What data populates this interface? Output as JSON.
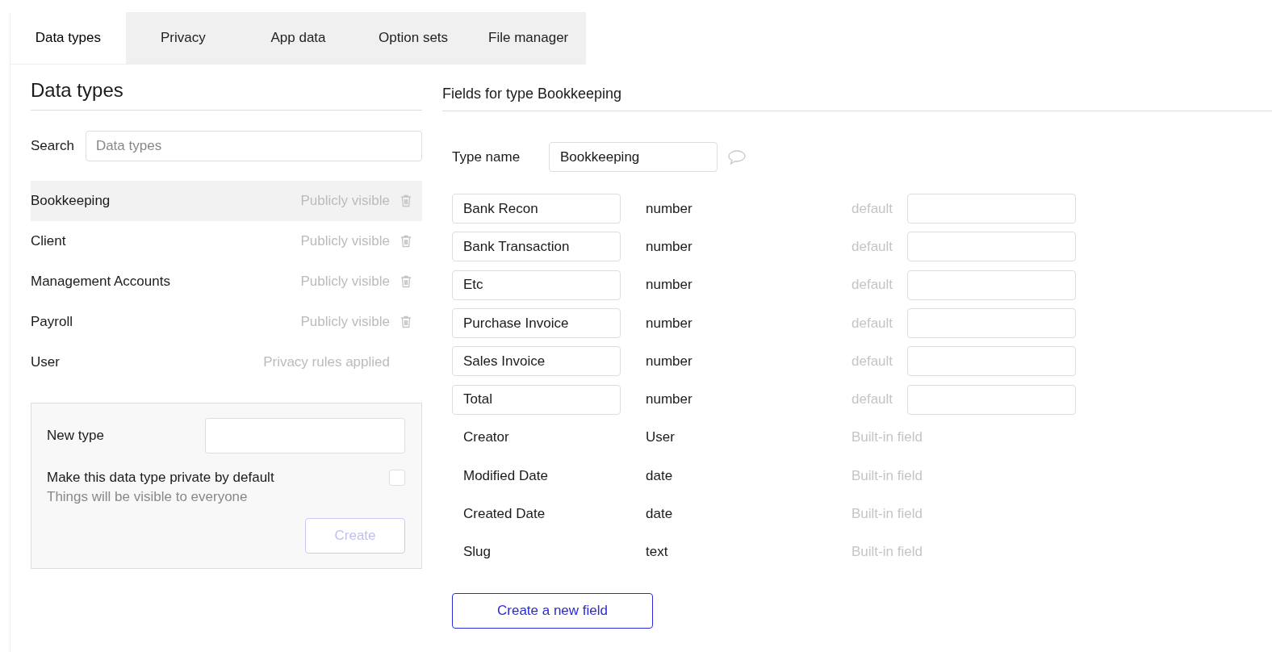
{
  "tabs": [
    {
      "label": "Data types",
      "selected": true
    },
    {
      "label": "Privacy",
      "selected": false
    },
    {
      "label": "App data",
      "selected": false
    },
    {
      "label": "Option sets",
      "selected": false
    },
    {
      "label": "File manager",
      "selected": false
    }
  ],
  "data_types": {
    "title": "Data types",
    "search": {
      "label": "Search",
      "placeholder": "Data types"
    },
    "items": [
      {
        "name": "Bookkeeping",
        "visibility": "Publicly visible",
        "deletable": true,
        "selected": true
      },
      {
        "name": "Client",
        "visibility": "Publicly visible",
        "deletable": true,
        "selected": false
      },
      {
        "name": "Management Accounts",
        "visibility": "Publicly visible",
        "deletable": true,
        "selected": false
      },
      {
        "name": "Payroll",
        "visibility": "Publicly visible",
        "deletable": true,
        "selected": false
      },
      {
        "name": "User",
        "visibility": "Privacy rules applied",
        "deletable": false,
        "selected": false
      }
    ],
    "new_type": {
      "label": "New type",
      "private_label": "Make this data type private by default",
      "private_checked": false,
      "hint": "Things will be visible to everyone",
      "button": "Create",
      "button_disabled": true
    }
  },
  "fields_panel": {
    "title": "Fields for type Bookkeeping",
    "type_name_label": "Type name",
    "type_name": "Bookkeeping",
    "fields": [
      {
        "kind": "custom",
        "name": "Bank Recon",
        "type": "number",
        "note": "default"
      },
      {
        "kind": "custom",
        "name": "Bank Transaction",
        "type": "number",
        "note": "default"
      },
      {
        "kind": "custom",
        "name": "Etc",
        "type": "number",
        "note": "default"
      },
      {
        "kind": "custom",
        "name": "Purchase Invoice",
        "type": "number",
        "note": "default"
      },
      {
        "kind": "custom",
        "name": "Sales Invoice",
        "type": "number",
        "note": "default"
      },
      {
        "kind": "custom",
        "name": "Total",
        "type": "number",
        "note": "default"
      },
      {
        "kind": "builtin",
        "name": "Creator",
        "type": "User",
        "note": "Built-in field"
      },
      {
        "kind": "builtin",
        "name": "Modified Date",
        "type": "date",
        "note": "Built-in field"
      },
      {
        "kind": "builtin",
        "name": "Created Date",
        "type": "date",
        "note": "Built-in field"
      },
      {
        "kind": "builtin",
        "name": "Slug",
        "type": "text",
        "note": "Built-in field"
      }
    ],
    "button": "Create a new field"
  }
}
